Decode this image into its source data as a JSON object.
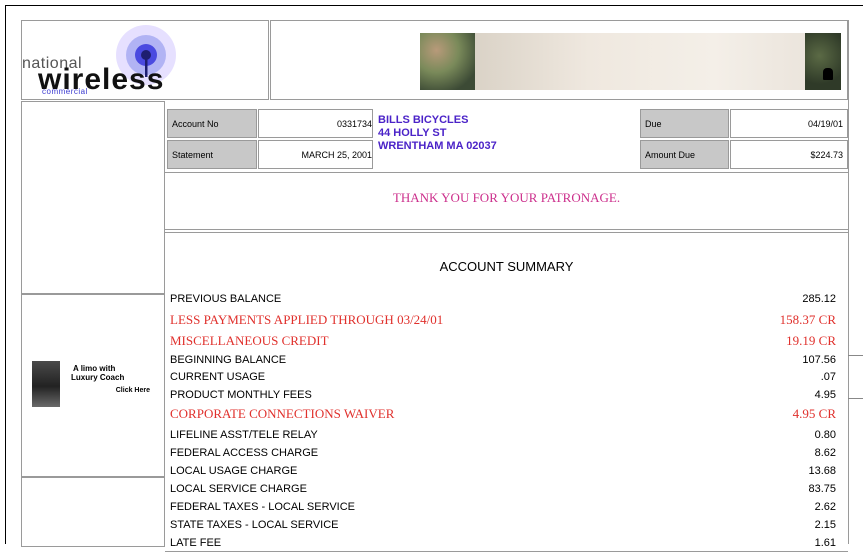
{
  "logo": {
    "top_text": "national",
    "main_text": "wireless",
    "sub_text": "commercial"
  },
  "header": {
    "account_no_label": "Account No",
    "account_no_value": "0331734",
    "statement_label": "Statement",
    "statement_value": "MARCH 25, 2001",
    "address": [
      "BILLS BICYCLES",
      "44 HOLLY ST",
      "WRENTHAM MA 02037"
    ],
    "due_label": "Due",
    "due_value": "04/19/01",
    "amount_due_label": "Amount Due",
    "amount_due_value": "$224.73"
  },
  "ad": {
    "line1": "A limo with",
    "line2": "Luxury Coach",
    "cta": "Click Here"
  },
  "thanks": "THANK YOU FOR YOUR PATRONAGE.",
  "summary": {
    "title": "ACCOUNT SUMMARY",
    "rows": [
      {
        "label": "PREVIOUS BALANCE",
        "amount": "285.12",
        "credit": false
      },
      {
        "label": "LESS PAYMENTS APPLIED THROUGH 03/24/01",
        "amount": "158.37 CR",
        "credit": true
      },
      {
        "label": "MISCELLANEOUS CREDIT",
        "amount": "19.19 CR",
        "credit": true
      },
      {
        "label": "BEGINNING BALANCE",
        "amount": "107.56",
        "credit": false
      },
      {
        "label": "CURRENT USAGE",
        "amount": ".07",
        "credit": false
      },
      {
        "label": "PRODUCT MONTHLY FEES",
        "amount": "4.95",
        "credit": false
      },
      {
        "label": "CORPORATE CONNECTIONS WAIVER",
        "amount": "4.95 CR",
        "credit": true
      },
      {
        "label": "LIFELINE ASST/TELE RELAY",
        "amount": "0.80",
        "credit": false
      },
      {
        "label": "FEDERAL ACCESS CHARGE",
        "amount": "8.62",
        "credit": false
      },
      {
        "label": "LOCAL USAGE CHARGE",
        "amount": "13.68",
        "credit": false
      },
      {
        "label": "LOCAL SERVICE CHARGE",
        "amount": "83.75",
        "credit": false
      },
      {
        "label": "FEDERAL TAXES - LOCAL SERVICE",
        "amount": "2.62",
        "credit": false
      },
      {
        "label": "STATE TAXES - LOCAL SERVICE",
        "amount": "2.15",
        "credit": false
      },
      {
        "label": "LATE FEE",
        "amount": "1.61",
        "credit": false
      }
    ]
  }
}
